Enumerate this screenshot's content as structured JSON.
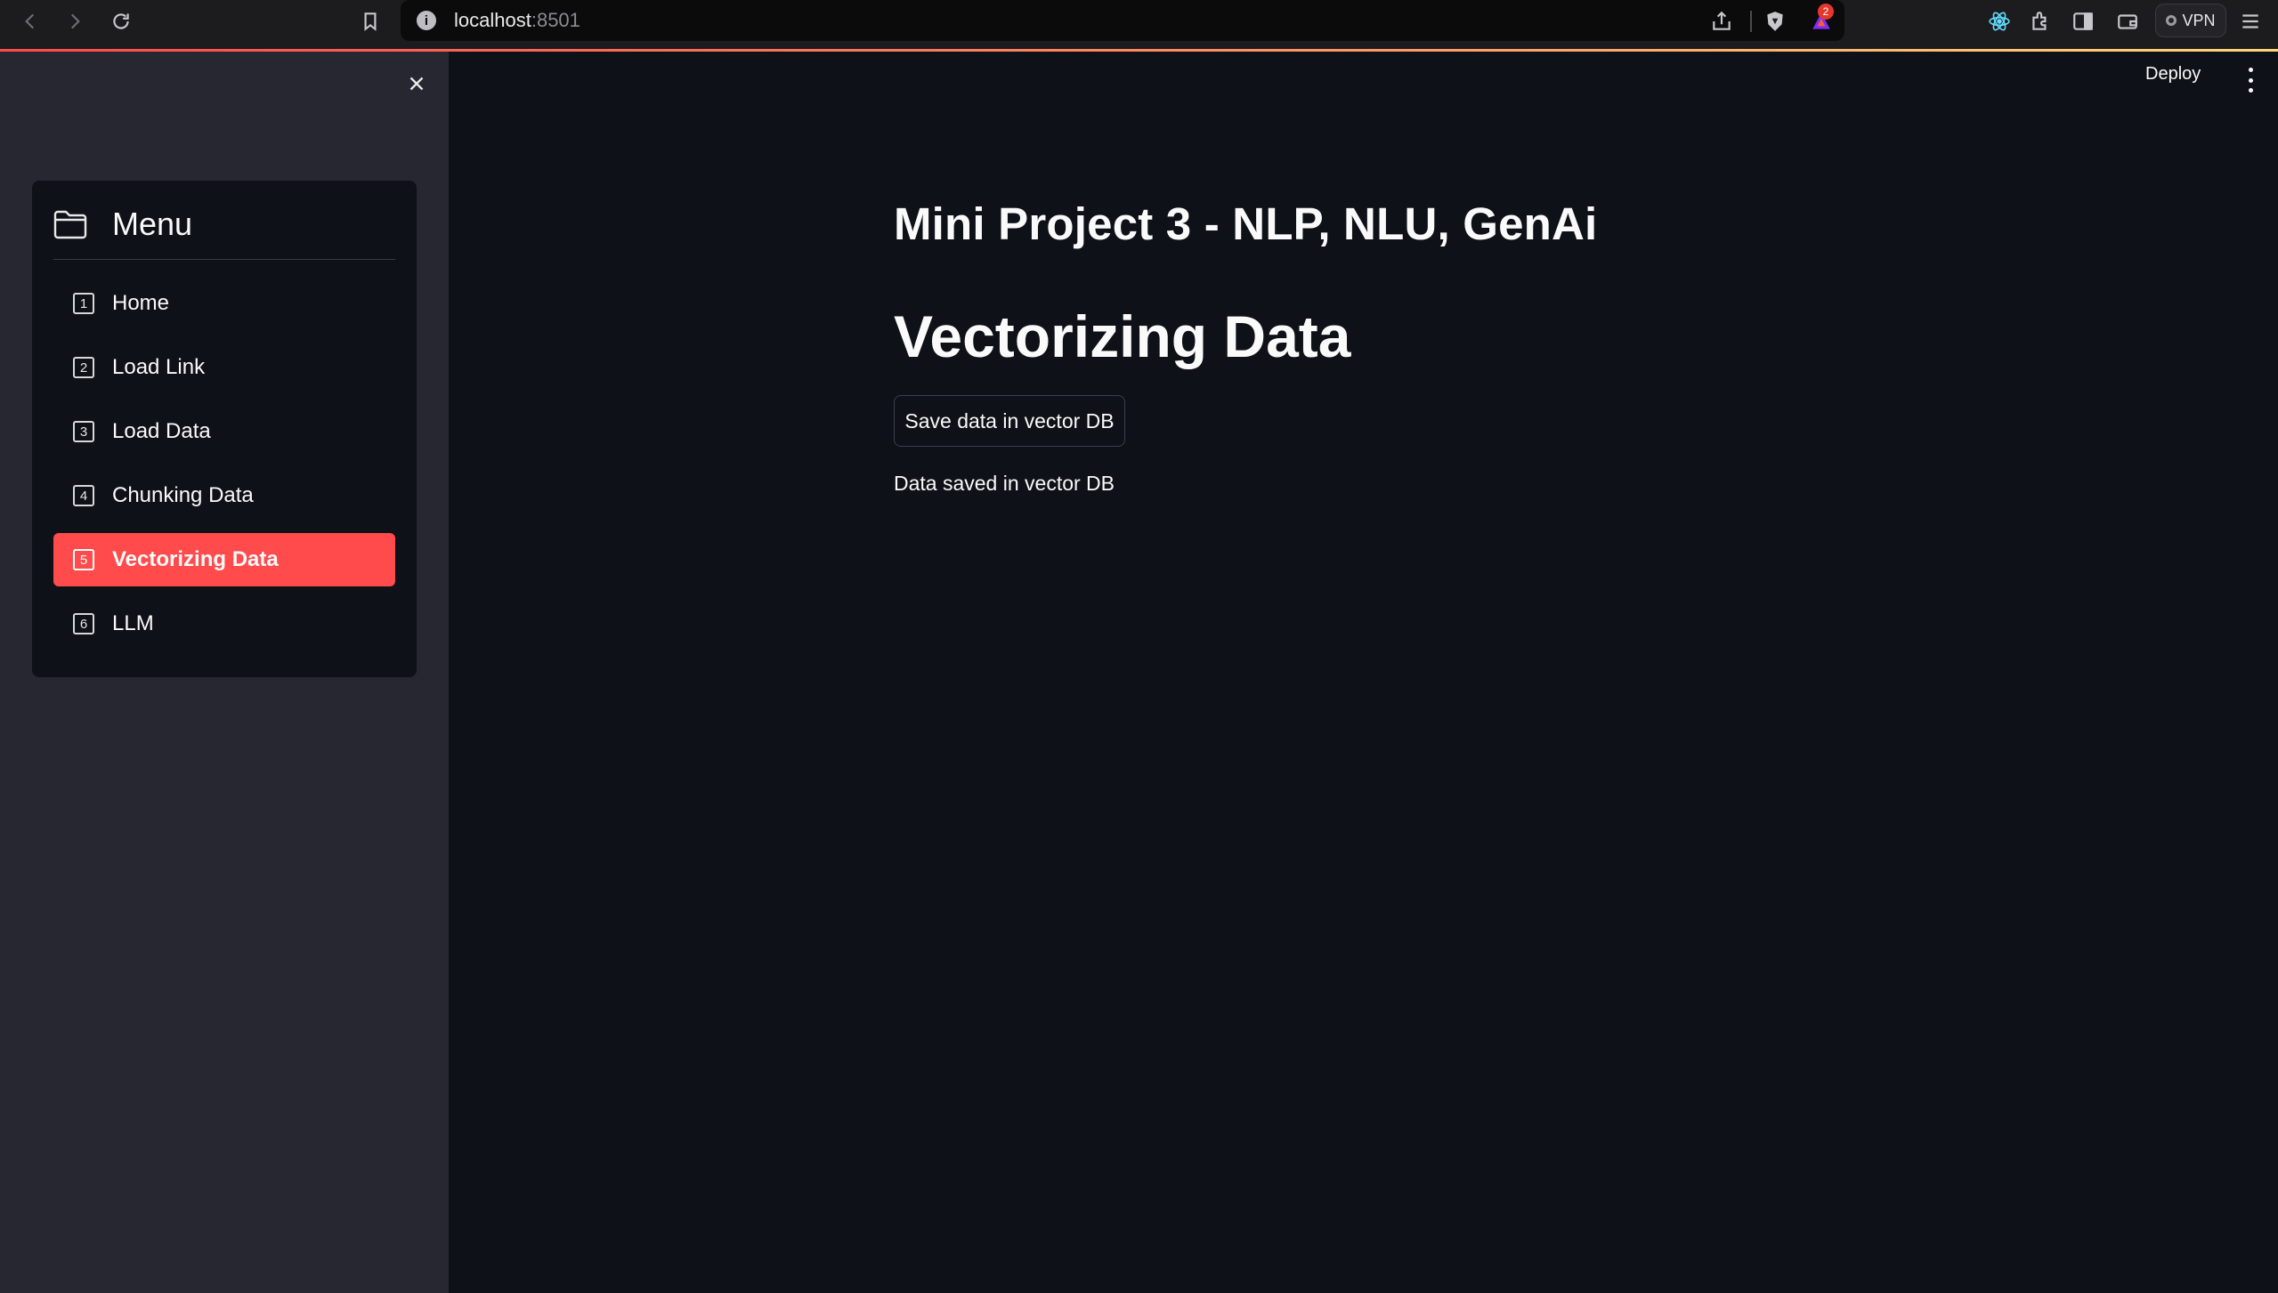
{
  "browser": {
    "url_host": "localhost",
    "url_port": ":8501",
    "notification_count": "2",
    "vpn_label": "VPN"
  },
  "sidebar": {
    "menu_title": "Menu",
    "items": [
      {
        "num": "1",
        "label": "Home",
        "active": false
      },
      {
        "num": "2",
        "label": "Load Link",
        "active": false
      },
      {
        "num": "3",
        "label": "Load Data",
        "active": false
      },
      {
        "num": "4",
        "label": "Chunking Data",
        "active": false
      },
      {
        "num": "5",
        "label": "Vectorizing Data",
        "active": true
      },
      {
        "num": "6",
        "label": "LLM",
        "active": false
      }
    ]
  },
  "header": {
    "deploy_label": "Deploy"
  },
  "main": {
    "app_title": "Mini Project 3 - NLP, NLU, GenAi",
    "page_heading": "Vectorizing Data",
    "save_button_label": "Save data in vector DB",
    "status_message": "Data saved in vector DB"
  },
  "colors": {
    "accent": "#ff4b4b",
    "background": "#0e1117",
    "sidebar": "#262730"
  }
}
